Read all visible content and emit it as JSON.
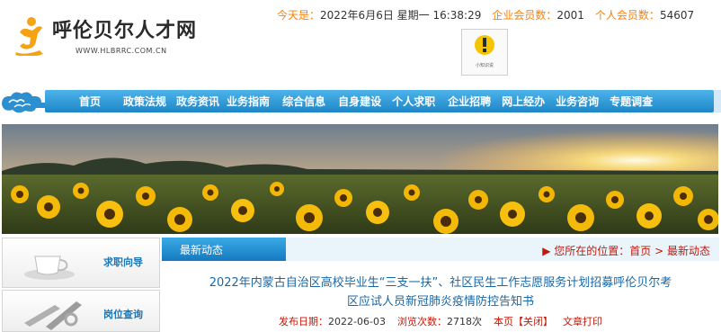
{
  "header": {
    "site_name": "呼伦贝尔人才网",
    "site_url": "WWW.HLBRRC.COM.CN",
    "today_label": "今天是：",
    "today_value": "2022年6月6日 星期一 16:38:29",
    "enterprise_label": "企业会员数：",
    "enterprise_count": "2001",
    "personal_label": "个人会员数：",
    "personal_count": "54607",
    "notice_caption": "小知识说"
  },
  "nav": {
    "items": [
      "首页",
      "政策法规",
      "政务资讯",
      "业务指南",
      "综合信息",
      "自身建设",
      "个人求职",
      "企业招聘",
      "网上经办",
      "业务咨询",
      "专题调查"
    ]
  },
  "sidebar": {
    "items": [
      {
        "label": "求职向导"
      },
      {
        "label": "岗位查询"
      }
    ]
  },
  "main": {
    "tab_label": "最新动态",
    "location_label": "您所在的位置：",
    "breadcrumb_home": "首页",
    "breadcrumb_sep": ">",
    "breadcrumb_current": "最新动态",
    "headline_line1": "2022年内蒙古自治区高校毕业生“三支一扶”、社区民生工作志愿服务计划招募呼伦贝尔考",
    "headline_line2": "区应试人员新冠肺炎疫情防控告知书",
    "publish_label": "发布日期：",
    "publish_date": "2022-06-03",
    "views_label": "浏览次数：",
    "views_count": "2718次",
    "close_link": "本页【关闭】",
    "print_link": "文章打印"
  },
  "colors": {
    "nav_blue": "#1e86c7",
    "accent_orange": "#ff7f00",
    "link_blue": "#1967a5",
    "meta_red": "#c3180a"
  }
}
